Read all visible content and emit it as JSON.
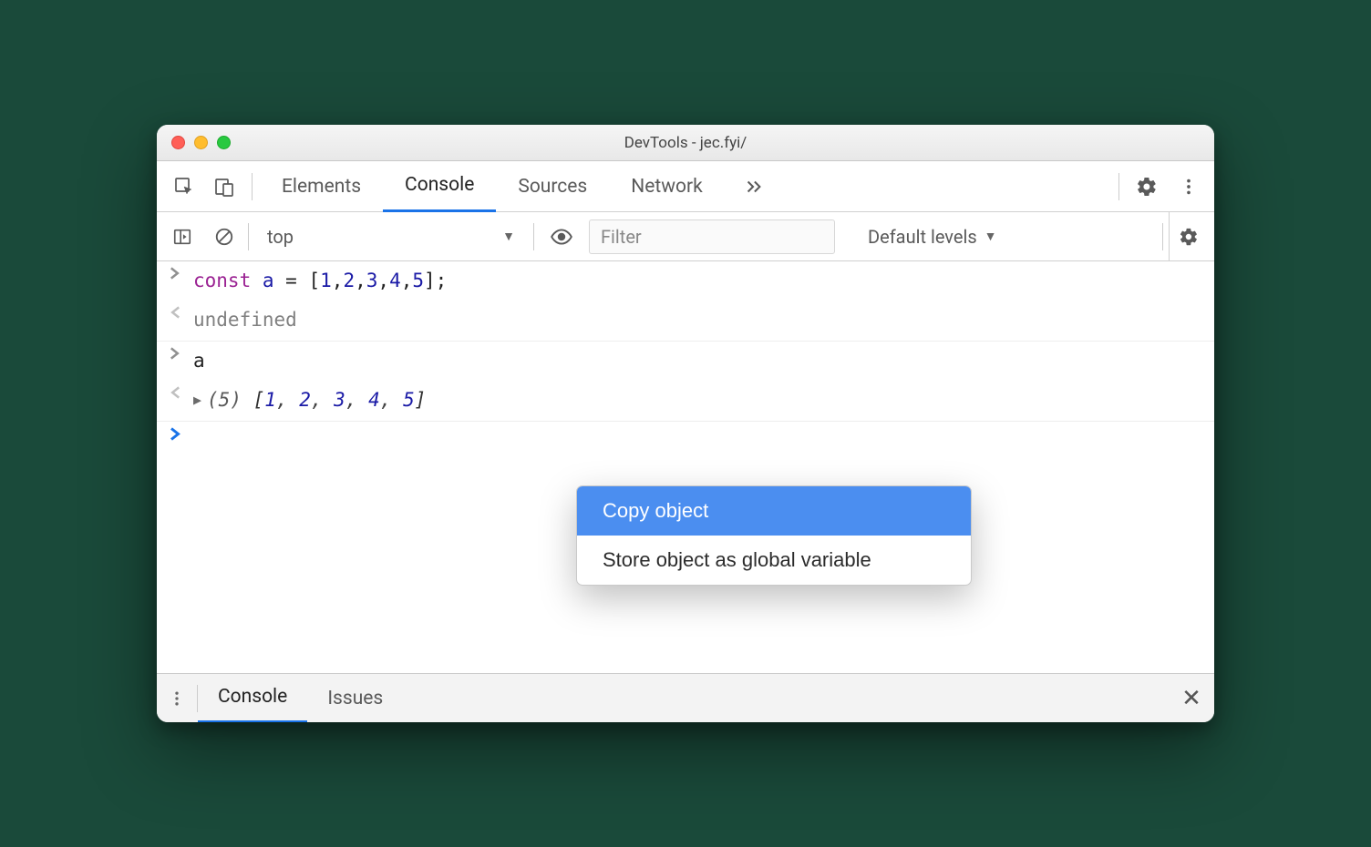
{
  "window": {
    "title": "DevTools - jec.fyi/"
  },
  "tabs": {
    "elements": "Elements",
    "console": "Console",
    "sources": "Sources",
    "network": "Network"
  },
  "toolbar": {
    "context": "top",
    "filter_placeholder": "Filter",
    "levels": "Default levels"
  },
  "console": {
    "line1": {
      "kw": "const",
      "var": "a",
      "eq": " = ",
      "open": "[",
      "nums": [
        "1",
        "2",
        "3",
        "4",
        "5"
      ],
      "close": "];"
    },
    "line2": "undefined",
    "line3": "a",
    "line4": {
      "length": "(5)",
      "open": " [",
      "values": [
        "1",
        "2",
        "3",
        "4",
        "5"
      ],
      "close": "]"
    }
  },
  "contextmenu": {
    "copy": "Copy object",
    "store": "Store object as global variable"
  },
  "drawer": {
    "console": "Console",
    "issues": "Issues"
  }
}
